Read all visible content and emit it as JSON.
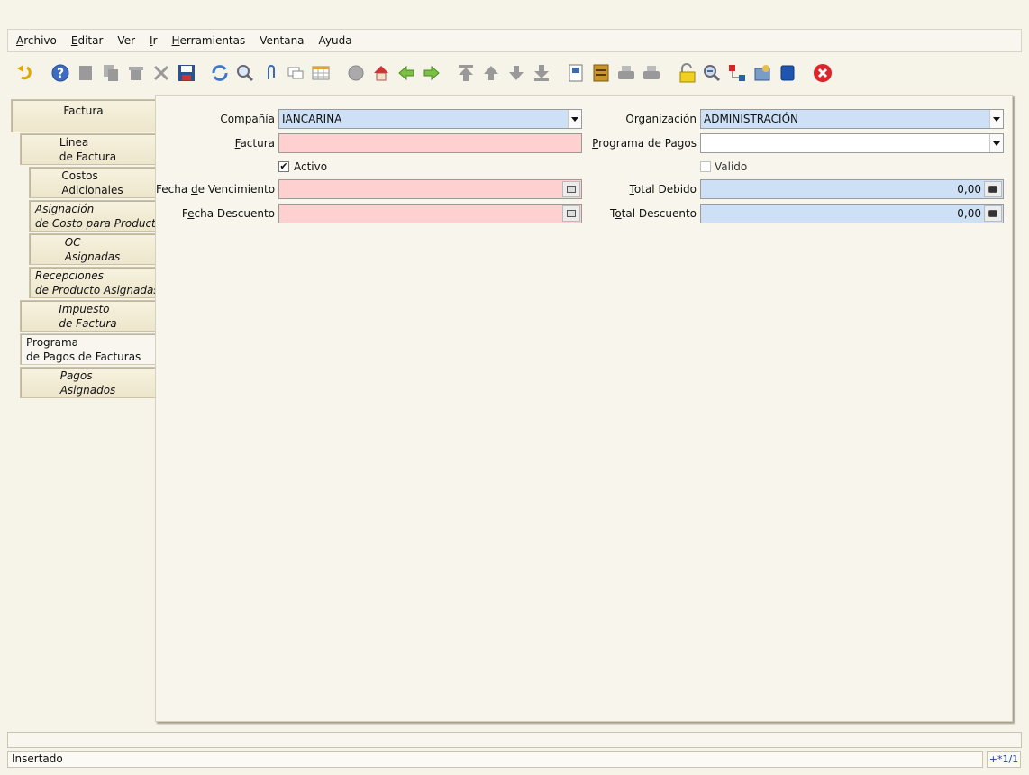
{
  "menu": [
    {
      "label": "Archivo",
      "mnemonic_index": 0
    },
    {
      "label": "Editar",
      "mnemonic_index": 0
    },
    {
      "label": "Ver",
      "mnemonic_index": -1
    },
    {
      "label": "Ir",
      "mnemonic_index": 0
    },
    {
      "label": "Herramientas",
      "mnemonic_index": 0
    },
    {
      "label": "Ventana",
      "mnemonic_index": -1
    },
    {
      "label": "Ayuda",
      "mnemonic_index": -1
    }
  ],
  "toolbar_icons": [
    "undo-icon",
    "help-icon",
    "new-record-icon",
    "copy-record-icon",
    "delete-record-icon",
    "delete-selection-icon",
    "save-icon",
    "refresh-icon",
    "find-icon",
    "attachment-icon",
    "chat-icon",
    "grid-toggle-icon",
    "history-icon",
    "home-icon",
    "back-icon",
    "forward-icon",
    "first-record-icon",
    "previous-record-icon",
    "next-record-icon",
    "last-record-icon",
    "report-icon",
    "archived-documents-icon",
    "print-preview-icon",
    "print-icon",
    "lock-icon",
    "zoom-across-icon",
    "workflow-icon",
    "requests-icon",
    "product-info-icon",
    "close-window-icon"
  ],
  "tabs": [
    {
      "label": "Factura",
      "italic": false,
      "active": false
    },
    {
      "label": "Línea\nde Factura",
      "italic": false,
      "active": false
    },
    {
      "label": "Costos\nAdicionales",
      "italic": false,
      "active": false
    },
    {
      "label": "Asignación\nde Costo para Producto",
      "italic": true,
      "active": false
    },
    {
      "label": "OC\nAsignadas",
      "italic": true,
      "active": false
    },
    {
      "label": "Recepciones\nde Producto Asignadas",
      "italic": true,
      "active": false
    },
    {
      "label": "Impuesto\nde Factura",
      "italic": true,
      "active": false
    },
    {
      "label": "Programa\nde Pagos de Facturas",
      "italic": false,
      "active": true
    },
    {
      "label": "Pagos\nAsignados",
      "italic": true,
      "active": false
    }
  ],
  "form": {
    "compania_label": "Compañía",
    "compania_value": "IANCARINA",
    "factura_label_pre": "",
    "factura_label_u": "F",
    "factura_label_post": "actura",
    "factura_value": "",
    "activo_label": "Activo",
    "activo_checked": true,
    "vencimiento_label_pre": "Fecha ",
    "vencimiento_label_u": "d",
    "vencimiento_label_post": "e Vencimiento",
    "vencimiento_value": "",
    "descuento_label_pre": "F",
    "descuento_label_u": "e",
    "descuento_label_post": "cha Descuento",
    "descuento_value": "",
    "organizacion_label": "Organización",
    "organizacion_value": "ADMINISTRACIÓN",
    "programa_label_u": "P",
    "programa_label_post": "rograma de Pagos",
    "programa_value": "",
    "valido_label": "Valido",
    "valido_checked": false,
    "total_debido_label_u": "T",
    "total_debido_label_post": "otal Debido",
    "total_debido_value": "0,00",
    "total_descuento_label_pre": "T",
    "total_descuento_label_u": "o",
    "total_descuento_label_post": "tal Descuento",
    "total_descuento_value": "0,00"
  },
  "status": {
    "message": "Insertado",
    "record_info": "+*1/1"
  },
  "colors": {
    "mandatory_bg": "#ffd0d0",
    "readonly_bg": "#cde0f5",
    "background": "#f6f3e8"
  }
}
